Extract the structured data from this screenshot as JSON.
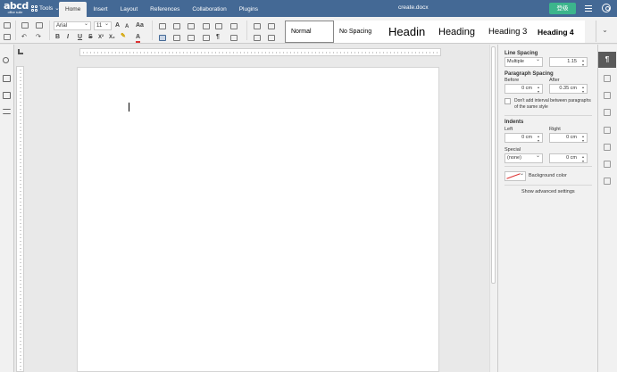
{
  "app": {
    "logo_text": "abcd",
    "logo_sub": "office suite",
    "tools_label": "Tools",
    "tabs": [
      {
        "label": "Home",
        "active": true
      },
      {
        "label": "Insert",
        "active": false
      },
      {
        "label": "Layout",
        "active": false
      },
      {
        "label": "References",
        "active": false
      },
      {
        "label": "Collaboration",
        "active": false
      },
      {
        "label": "Plugins",
        "active": false
      }
    ],
    "document_title": "create.docx",
    "upgrade_label": "登级",
    "colors": {
      "header": "#446995",
      "upgrade": "#3cb58c"
    }
  },
  "toolbar": {
    "font_name": "Arial",
    "font_size": "11",
    "grow_font": "A",
    "shrink_font": "A",
    "change_case": "Aa",
    "bold": "B",
    "italic": "I",
    "underline": "U",
    "strikethrough": "S",
    "superscript": "X²",
    "subscript": "X₂",
    "font_color": "A",
    "paragraph_mark": "¶",
    "styles": [
      {
        "label": "Normal",
        "selected": true
      },
      {
        "label": "No Spacing",
        "selected": false
      },
      {
        "label": "Headin",
        "selected": false
      },
      {
        "label": "Heading",
        "selected": false
      },
      {
        "label": "Heading 3",
        "selected": false
      },
      {
        "label": "Heading 4",
        "selected": false
      }
    ]
  },
  "panel": {
    "line_spacing_title": "Line Spacing",
    "line_spacing_type": "Multiple",
    "line_spacing_value": "1.15",
    "paragraph_spacing_title": "Paragraph Spacing",
    "before_label": "Before",
    "after_label": "After",
    "before_value": "0 cm",
    "after_value": "0.35 cm",
    "dont_add_interval": "Don't add interval between paragraphs of the same style",
    "indents_title": "Indents",
    "left_label": "Left",
    "right_label": "Right",
    "left_value": "0 cm",
    "right_value": "0 cm",
    "special_label": "Special",
    "special_value": "(none)",
    "special_amount": "0 cm",
    "background_color_label": "Background color",
    "advanced_settings": "Show advanced settings"
  },
  "rightbar": {
    "active_icon": "¶"
  }
}
